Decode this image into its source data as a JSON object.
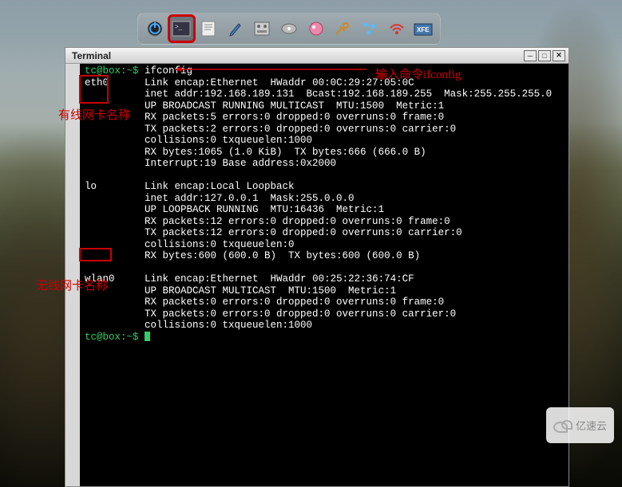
{
  "window": {
    "title": "Terminal"
  },
  "prompt": "tc@box:~$",
  "command": "ifconfig",
  "interfaces": {
    "eth0": {
      "name": "eth0",
      "l1": "Link encap:Ethernet  HWaddr 00:0C:29:27:05:0C",
      "l2": "inet addr:192.168.189.131  Bcast:192.168.189.255  Mask:255.255.255.0",
      "l3": "UP BROADCAST RUNNING MULTICAST  MTU:1500  Metric:1",
      "l4": "RX packets:5 errors:0 dropped:0 overruns:0 frame:0",
      "l5": "TX packets:2 errors:0 dropped:0 overruns:0 carrier:0",
      "l6": "collisions:0 txqueuelen:1000",
      "l7": "RX bytes:1065 (1.0 KiB)  TX bytes:666 (666.0 B)",
      "l8": "Interrupt:19 Base address:0x2000"
    },
    "lo": {
      "name": "lo",
      "l1": "Link encap:Local Loopback",
      "l2": "inet addr:127.0.0.1  Mask:255.0.0.0",
      "l3": "UP LOOPBACK RUNNING  MTU:16436  Metric:1",
      "l4": "RX packets:12 errors:0 dropped:0 overruns:0 frame:0",
      "l5": "TX packets:12 errors:0 dropped:0 overruns:0 carrier:0",
      "l6": "collisions:0 txqueuelen:0",
      "l7": "RX bytes:600 (600.0 B)  TX bytes:600 (600.0 B)"
    },
    "wlan0": {
      "name": "wlan0",
      "l1": "Link encap:Ethernet  HWaddr 00:25:22:36:74:CF",
      "l2": "UP BROADCAST MULTICAST  MTU:1500  Metric:1",
      "l3": "RX packets:0 errors:0 dropped:0 overruns:0 frame:0",
      "l4": "TX packets:0 errors:0 dropped:0 overruns:0 carrier:0",
      "l5": "collisions:0 txqueuelen:1000"
    }
  },
  "annotations": {
    "cmd_hint": "输入命令ifconfig",
    "wired_label": "有线网卡名称",
    "wireless_label": "无线网卡名称"
  },
  "taskbar_icons": [
    "power",
    "terminal",
    "editor",
    "pencil",
    "control",
    "disk",
    "mount",
    "tools",
    "network",
    "wifi",
    "filemanager"
  ],
  "watermark": "亿速云"
}
